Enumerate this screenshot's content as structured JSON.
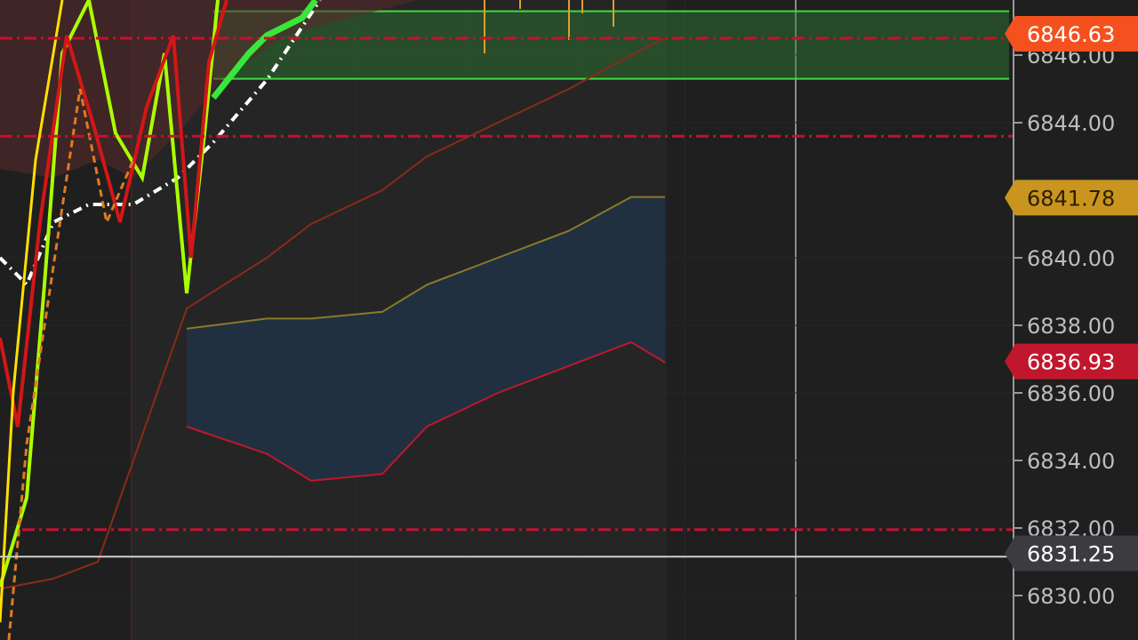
{
  "chart_data": {
    "type": "line",
    "title": "",
    "xlabel": "",
    "ylabel": "",
    "ylim": [
      6829.0,
      6848.0
    ],
    "grid": true,
    "y_ticks": [
      "6846.00",
      "6844.00",
      "6840.00",
      "6838.00",
      "6836.00",
      "6834.00",
      "6832.00",
      "6830.00"
    ],
    "y_tick_values": [
      6846,
      6844,
      6840,
      6838,
      6836,
      6834,
      6832,
      6830
    ],
    "price_badges": [
      {
        "label": "6846.63",
        "value": 6846.63,
        "color": "#f4511e",
        "text_color": "#ffffff"
      },
      {
        "label": "6841.78",
        "value": 6841.78,
        "color": "#c9951e",
        "text_color": "#2a2000"
      },
      {
        "label": "6836.93",
        "value": 6836.93,
        "color": "#c0172d",
        "text_color": "#ffffff"
      },
      {
        "label": "6831.25",
        "value": 6831.25,
        "color": "#3b3b40",
        "text_color": "#ffffff"
      }
    ],
    "horizontal_levels": [
      {
        "name": "red-dash-level-upper",
        "value": 6846.5,
        "color": "#c8102e"
      },
      {
        "name": "red-dash-level-middle",
        "value": 6843.6,
        "color": "#c8102e"
      },
      {
        "name": "red-dash-level-lower",
        "value": 6831.95,
        "color": "#c8102e"
      },
      {
        "name": "current-price-line",
        "value": 6831.15,
        "color": "#cfcfcf"
      }
    ],
    "zone": {
      "top": 6847.3,
      "bottom": 6845.3,
      "color": "#2e7d32"
    },
    "series": [
      {
        "name": "upper-band",
        "color": "#8b2a1a",
        "values": [
          6830.2,
          6830.5,
          6831.0,
          6838.5,
          6840.0,
          6841.0,
          6842.0,
          6843.0,
          6844.0,
          6845.0,
          6846.0,
          6846.5
        ]
      },
      {
        "name": "mid-band",
        "color": "#8a7a2a",
        "values": [
          null,
          null,
          null,
          6837.9,
          6838.2,
          6838.2,
          6838.4,
          6839.2,
          6840.0,
          6840.8,
          6841.8,
          6841.8
        ]
      },
      {
        "name": "lower-band",
        "color": "#c0172d",
        "values": [
          null,
          null,
          null,
          6835.0,
          6834.2,
          6833.4,
          6833.6,
          6835.0,
          6836.0,
          6836.8,
          6837.5,
          6836.9
        ]
      }
    ]
  }
}
